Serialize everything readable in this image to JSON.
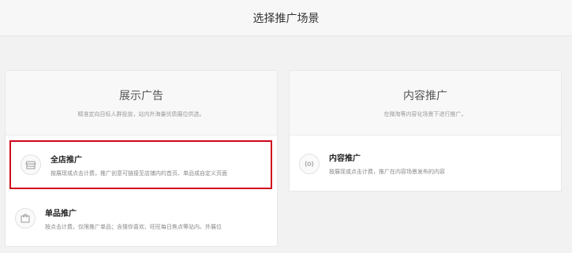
{
  "header": {
    "title": "选择推广场景"
  },
  "display_card": {
    "title": "展示广告",
    "subtitle": "精准定向目标人群投放，站内外海量优质展位供选。",
    "options": [
      {
        "name": "全店推广",
        "desc": "按展现或点击计费，推广创意可链接至店铺内的首页、单品或自定义页面",
        "icon": "store-icon",
        "selected": true
      },
      {
        "name": "单品推广",
        "desc": "按点击计费，仅限推广单品；含猜你喜欢、旺旺每日焦点等站内、外展位",
        "icon": "shopping-bag-icon",
        "selected": false
      }
    ]
  },
  "content_card": {
    "title": "内容推广",
    "subtitle": "在微淘等内容化场景下进行推广。",
    "options": [
      {
        "name": "内容推广",
        "desc": "按展现或点击计费，推广在内容场景发布的内容",
        "icon": "broadcast-icon",
        "selected": false
      }
    ]
  },
  "colors": {
    "selected_border": "#d0021b"
  }
}
